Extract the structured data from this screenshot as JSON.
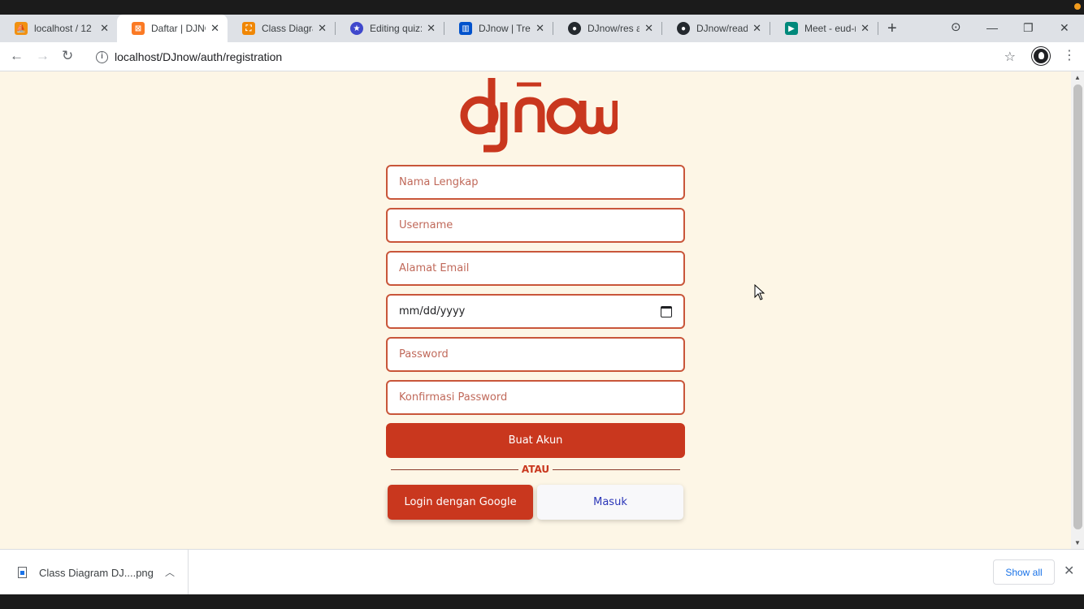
{
  "tabs": [
    {
      "title": "localhost / 12",
      "icon": "phpmyadmin-icon",
      "color": "#f29111"
    },
    {
      "title": "Daftar | DJNO",
      "icon": "xampp-icon",
      "color": "#fb7a24",
      "active": true
    },
    {
      "title": "Class Diagram",
      "icon": "drawio-icon",
      "color": "#f08705"
    },
    {
      "title": "Editing quiz: ",
      "icon": "quiz-icon",
      "color": "#3f48cc"
    },
    {
      "title": "DJnow | Trello",
      "icon": "trello-icon",
      "color": "#0052cc"
    },
    {
      "title": "DJnow/res at",
      "icon": "github-icon",
      "color": "#24292e"
    },
    {
      "title": "DJnow/readm",
      "icon": "github-icon",
      "color": "#24292e"
    },
    {
      "title": "Meet - eud-n",
      "icon": "meet-icon",
      "color": "#00897b"
    }
  ],
  "browser": {
    "url": "localhost/DJnow/auth/registration",
    "new_tab": "+",
    "minimize": "—",
    "restore": "❐",
    "close": "✕"
  },
  "brand": {
    "logo_text": "djnow",
    "color": "#c9371e"
  },
  "form": {
    "full_name_placeholder": "Nama Lengkap",
    "username_placeholder": "Username",
    "email_placeholder": "Alamat Email",
    "date_value": "mm/dd/yyyy",
    "password_placeholder": "Password",
    "confirm_password_placeholder": "Konfirmasi Password",
    "submit_label": "Buat Akun",
    "divider_label": "ATAU",
    "google_label": "Login dengan Google",
    "login_label": "Masuk"
  },
  "downloads": {
    "file_name": "Class Diagram DJ....png",
    "show_all": "Show all"
  },
  "colors": {
    "accent": "#c9371e",
    "page_bg": "#fdf6e6",
    "link": "#2b36b8"
  }
}
